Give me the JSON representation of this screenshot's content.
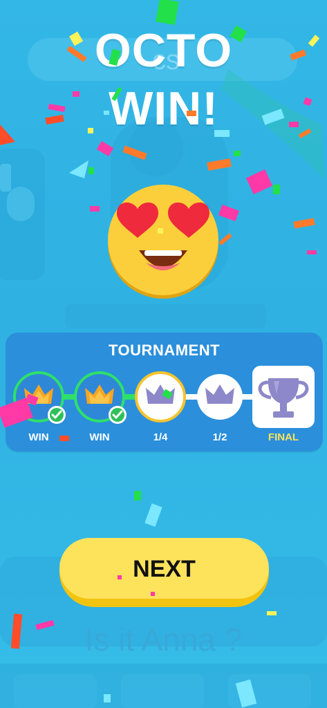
{
  "title": {
    "line1": "OCTO",
    "line2": "WIN!"
  },
  "background": {
    "search_hint": "cs",
    "question_text": "Is it Anna ?"
  },
  "tournament": {
    "heading": "TOURNAMENT",
    "stages": [
      {
        "label": "WIN",
        "state": "won",
        "icon": "crown-icon"
      },
      {
        "label": "WIN",
        "state": "won",
        "icon": "crown-icon"
      },
      {
        "label": "1/4",
        "state": "current",
        "icon": "crown-icon"
      },
      {
        "label": "1/2",
        "state": "locked",
        "icon": "crown-icon"
      },
      {
        "label": "FINAL",
        "state": "locked",
        "icon": "trophy-icon"
      }
    ]
  },
  "next_button": {
    "label": "NEXT"
  },
  "colors": {
    "background": "#33b7e6",
    "panel": "#2b8fdb",
    "won_ring": "#2ee06b",
    "current_ring": "#f4c430",
    "crown_gold": "#f6a623",
    "crown_locked": "#8c88c9",
    "final_label": "#ffe35a",
    "button": "#fde25c"
  },
  "emoji": "heart-eyes-emoji"
}
